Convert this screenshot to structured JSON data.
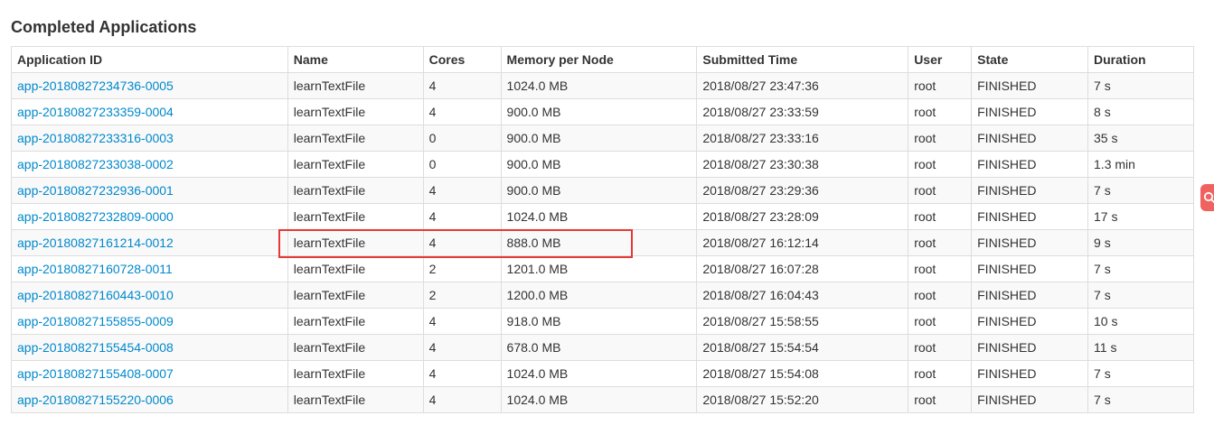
{
  "title": "Completed Applications",
  "table": {
    "headers": [
      "Application ID",
      "Name",
      "Cores",
      "Memory per Node",
      "Submitted Time",
      "User",
      "State",
      "Duration"
    ],
    "rows": [
      [
        "app-20180827234736-0005",
        "learnTextFile",
        "4",
        "1024.0 MB",
        "2018/08/27 23:47:36",
        "root",
        "FINISHED",
        "7 s"
      ],
      [
        "app-20180827233359-0004",
        "learnTextFile",
        "4",
        "900.0 MB",
        "2018/08/27 23:33:59",
        "root",
        "FINISHED",
        "8 s"
      ],
      [
        "app-20180827233316-0003",
        "learnTextFile",
        "0",
        "900.0 MB",
        "2018/08/27 23:33:16",
        "root",
        "FINISHED",
        "35 s"
      ],
      [
        "app-20180827233038-0002",
        "learnTextFile",
        "0",
        "900.0 MB",
        "2018/08/27 23:30:38",
        "root",
        "FINISHED",
        "1.3 min"
      ],
      [
        "app-20180827232936-0001",
        "learnTextFile",
        "4",
        "900.0 MB",
        "2018/08/27 23:29:36",
        "root",
        "FINISHED",
        "7 s"
      ],
      [
        "app-20180827232809-0000",
        "learnTextFile",
        "4",
        "1024.0 MB",
        "2018/08/27 23:28:09",
        "root",
        "FINISHED",
        "17 s"
      ],
      [
        "app-20180827161214-0012",
        "learnTextFile",
        "4",
        "888.0 MB",
        "2018/08/27 16:12:14",
        "root",
        "FINISHED",
        "9 s"
      ],
      [
        "app-20180827160728-0011",
        "learnTextFile",
        "2",
        "1201.0 MB",
        "2018/08/27 16:07:28",
        "root",
        "FINISHED",
        "7 s"
      ],
      [
        "app-20180827160443-0010",
        "learnTextFile",
        "2",
        "1200.0 MB",
        "2018/08/27 16:04:43",
        "root",
        "FINISHED",
        "7 s"
      ],
      [
        "app-20180827155855-0009",
        "learnTextFile",
        "4",
        "918.0 MB",
        "2018/08/27 15:58:55",
        "root",
        "FINISHED",
        "10 s"
      ],
      [
        "app-20180827155454-0008",
        "learnTextFile",
        "4",
        "678.0 MB",
        "2018/08/27 15:54:54",
        "root",
        "FINISHED",
        "11 s"
      ],
      [
        "app-20180827155408-0007",
        "learnTextFile",
        "4",
        "1024.0 MB",
        "2018/08/27 15:54:08",
        "root",
        "FINISHED",
        "7 s"
      ],
      [
        "app-20180827155220-0006",
        "learnTextFile",
        "4",
        "1024.0 MB",
        "2018/08/27 15:52:20",
        "root",
        "FINISHED",
        "7 s"
      ]
    ]
  },
  "highlighted_row": "app-20180827161214-0012",
  "colors": {
    "link": "#0088cc",
    "highlight_border": "#e53935",
    "stripe": "#f9f9f9",
    "side_widget": "#f0625f"
  },
  "side_widget_icon": "search-icon"
}
